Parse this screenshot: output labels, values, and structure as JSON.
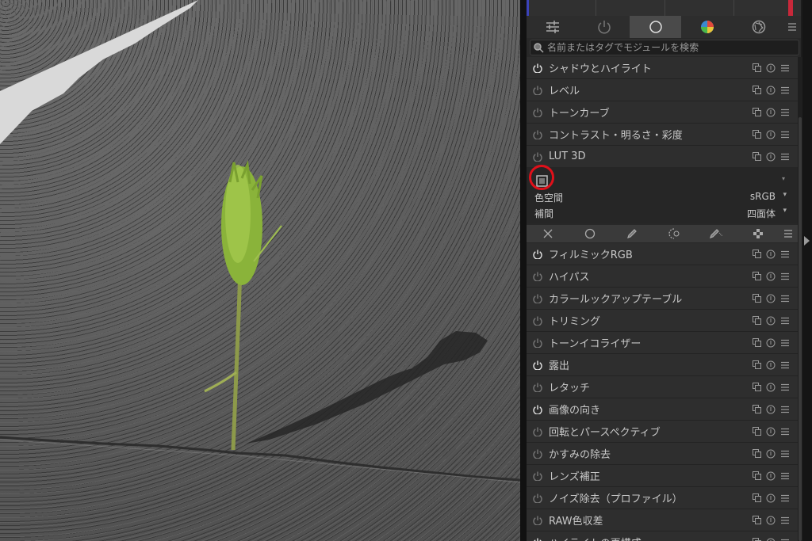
{
  "search": {
    "placeholder": "名前またはタグでモジュールを検索"
  },
  "group_tabs": [
    {
      "icon": "sliders-icon"
    },
    {
      "icon": "power-icon"
    },
    {
      "icon": "circle-icon"
    },
    {
      "icon": "color-wheel-icon"
    },
    {
      "icon": "aperture-icon"
    }
  ],
  "modules_top": [
    {
      "label": "シャドウとハイライト",
      "on": true
    },
    {
      "label": "レベル",
      "on": false
    },
    {
      "label": "トーンカーブ",
      "on": false
    },
    {
      "label": "コントラスト・明るさ・彩度",
      "on": false
    },
    {
      "label": "LUT 3D",
      "on": false
    }
  ],
  "lut_params": {
    "colorspace_label": "色空間",
    "colorspace_value": "sRGB",
    "interp_label": "補間",
    "interp_value": "四面体"
  },
  "modules_bottom": [
    {
      "label": "フィルミックRGB",
      "on": true
    },
    {
      "label": "ハイパス",
      "on": false
    },
    {
      "label": "カラールックアップテーブル",
      "on": false
    },
    {
      "label": "トリミング",
      "on": false
    },
    {
      "label": "トーンイコライザー",
      "on": false
    },
    {
      "label": "露出",
      "on": true
    },
    {
      "label": "レタッチ",
      "on": false
    },
    {
      "label": "画像の向き",
      "on": true
    },
    {
      "label": "回転とパースペクティブ",
      "on": false
    },
    {
      "label": "かすみの除去",
      "on": false
    },
    {
      "label": "レンズ補正",
      "on": false
    },
    {
      "label": "ノイズ除去（プロファイル）",
      "on": false
    },
    {
      "label": "RAW色収差",
      "on": false
    },
    {
      "label": "ハイライトの再構成",
      "on": true
    }
  ],
  "colors": {
    "accent_ring": "#e0101a",
    "panel_bg": "#282828",
    "row_bg": "#2e2e2e"
  }
}
